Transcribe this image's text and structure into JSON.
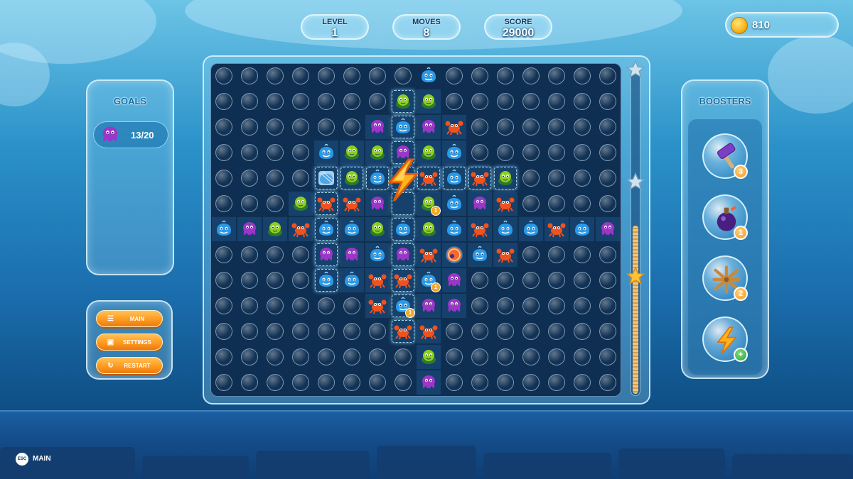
{
  "hud": {
    "level_label": "LEVEL",
    "level_value": "1",
    "moves_label": "MOVES",
    "moves_value": "8",
    "score_label": "SCORE",
    "score_value": "29000",
    "coins_value": "810"
  },
  "goals": {
    "title": "GOALS",
    "items": [
      {
        "creature": "purple-octopus",
        "count": "13/20"
      }
    ]
  },
  "menu": {
    "main_label": "MAIN",
    "settings_label": "SETTINGS",
    "restart_label": "RESTART"
  },
  "boosters": {
    "title": "BOOSTERS",
    "items": [
      {
        "name": "hammer",
        "count": "3"
      },
      {
        "name": "bomb-potion",
        "count": "1"
      },
      {
        "name": "rope-net",
        "count": "2"
      },
      {
        "name": "lightning",
        "count": "+"
      }
    ]
  },
  "footer": {
    "key": "ESC",
    "label": "MAIN"
  },
  "progress": {
    "fill_fraction": 0.52
  },
  "colors": {
    "whale": "#2a9ae8",
    "crab": "#f0521f",
    "octopus": "#9b36c9",
    "turtle": "#8bcf1e",
    "accent_orange": "#ff9a1f",
    "board_bg": "#0f2f52"
  },
  "board": {
    "cols": 16,
    "rows": 13,
    "legend": {
      ".": "bubble",
      "W": "whale",
      "C": "crab",
      "O": "octopus",
      "T": "turtle",
      "L": "lightning",
      "S": "ice-whale",
      "R": "red-shell",
      "e": "empty"
    },
    "grid": [
      "........W.......",
      ".......TT.......",
      "......OWOC......",
      "....WTTOTW......",
      "....STWLCWCT....",
      "...TCCOeTWOC....",
      "WOTCWWTWTWCWWCWO",
      "....OOWOCRWC....",
      "....WWCCWO......",
      "......CWOO......",
      ".......CC.......",
      "........T.......",
      "........O......."
    ],
    "tile_cells": [
      [
        1,
        7
      ],
      [
        1,
        8
      ],
      [
        2,
        6
      ],
      [
        2,
        7
      ],
      [
        2,
        8
      ],
      [
        2,
        9
      ],
      [
        3,
        4
      ],
      [
        3,
        5
      ],
      [
        3,
        6
      ],
      [
        3,
        7
      ],
      [
        3,
        8
      ],
      [
        3,
        9
      ],
      [
        4,
        4
      ],
      [
        4,
        5
      ],
      [
        4,
        6
      ],
      [
        4,
        7
      ],
      [
        4,
        8
      ],
      [
        4,
        9
      ],
      [
        4,
        10
      ],
      [
        4,
        11
      ],
      [
        5,
        3
      ],
      [
        5,
        4
      ],
      [
        5,
        5
      ],
      [
        5,
        6
      ],
      [
        5,
        7
      ],
      [
        5,
        8
      ],
      [
        5,
        9
      ],
      [
        5,
        10
      ],
      [
        5,
        11
      ],
      [
        6,
        0
      ],
      [
        6,
        1
      ],
      [
        6,
        2
      ],
      [
        6,
        3
      ],
      [
        6,
        4
      ],
      [
        6,
        5
      ],
      [
        6,
        6
      ],
      [
        6,
        7
      ],
      [
        6,
        8
      ],
      [
        6,
        9
      ],
      [
        6,
        10
      ],
      [
        6,
        11
      ],
      [
        6,
        12
      ],
      [
        6,
        13
      ],
      [
        6,
        14
      ],
      [
        6,
        15
      ],
      [
        7,
        4
      ],
      [
        7,
        5
      ],
      [
        7,
        6
      ],
      [
        7,
        7
      ],
      [
        7,
        8
      ],
      [
        7,
        9
      ],
      [
        7,
        10
      ],
      [
        7,
        11
      ],
      [
        8,
        4
      ],
      [
        8,
        5
      ],
      [
        8,
        6
      ],
      [
        8,
        7
      ],
      [
        8,
        8
      ],
      [
        8,
        9
      ],
      [
        9,
        6
      ],
      [
        9,
        7
      ],
      [
        9,
        8
      ],
      [
        9,
        9
      ],
      [
        10,
        7
      ],
      [
        10,
        8
      ],
      [
        11,
        8
      ],
      [
        12,
        8
      ]
    ],
    "selected_cells": [
      [
        1,
        7
      ],
      [
        2,
        7
      ],
      [
        3,
        7
      ],
      [
        4,
        7
      ],
      [
        5,
        7
      ],
      [
        6,
        7
      ],
      [
        7,
        7
      ],
      [
        8,
        7
      ],
      [
        9,
        7
      ],
      [
        10,
        7
      ],
      [
        4,
        4
      ],
      [
        4,
        5
      ],
      [
        4,
        6
      ],
      [
        4,
        8
      ],
      [
        4,
        9
      ],
      [
        4,
        10
      ],
      [
        4,
        11
      ],
      [
        5,
        4
      ],
      [
        6,
        4
      ],
      [
        7,
        4
      ],
      [
        8,
        4
      ]
    ],
    "counters": [
      {
        "row": 5,
        "col": 8,
        "value": "1"
      },
      {
        "row": 8,
        "col": 8,
        "value": "1"
      },
      {
        "row": 9,
        "col": 7,
        "value": "1"
      }
    ]
  }
}
